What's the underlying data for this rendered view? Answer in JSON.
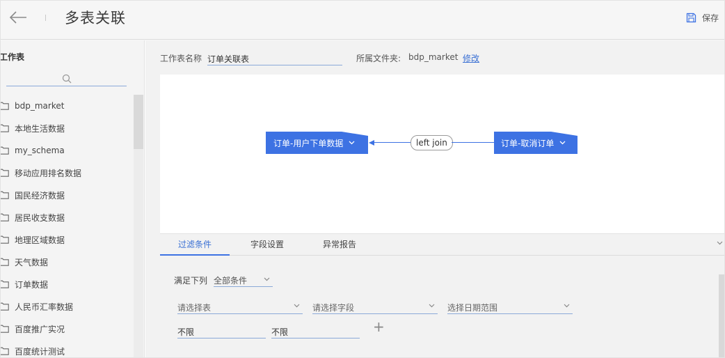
{
  "header": {
    "title": "多表关联",
    "save_label": "保存"
  },
  "sidebar": {
    "title": "工作表",
    "items": [
      {
        "label": "bdp_market"
      },
      {
        "label": "本地生活数据"
      },
      {
        "label": "my_schema"
      },
      {
        "label": "移动应用排名数据"
      },
      {
        "label": "国民经济数据"
      },
      {
        "label": "居民收支数据"
      },
      {
        "label": "地理区域数据"
      },
      {
        "label": "天气数据"
      },
      {
        "label": "订单数据"
      },
      {
        "label": "人民币汇率数据"
      },
      {
        "label": "百度推广实况"
      },
      {
        "label": "百度统计测试"
      }
    ]
  },
  "worksheet": {
    "name_label": "工作表名称",
    "name_value": "订单关联表",
    "folder_label": "所属文件夹:",
    "folder_value": "bdp_market",
    "folder_edit": "修改"
  },
  "diagram": {
    "left_node": "订单-用户下单数据",
    "join_label": "left join",
    "right_node": "订单-取消订单",
    "accent_color": "#3d72e3"
  },
  "tabs": [
    {
      "label": "过滤条件",
      "active": true
    },
    {
      "label": "字段设置",
      "active": false
    },
    {
      "label": "异常报告",
      "active": false
    }
  ],
  "filter": {
    "condition_label": "满足下列",
    "condition_value": "全部条件",
    "select_table_placeholder": "请选择表",
    "select_field_placeholder": "请选择字段",
    "select_date_placeholder": "选择日期范围",
    "range_from": "不限",
    "range_to": "不限",
    "add_symbol": "+"
  }
}
